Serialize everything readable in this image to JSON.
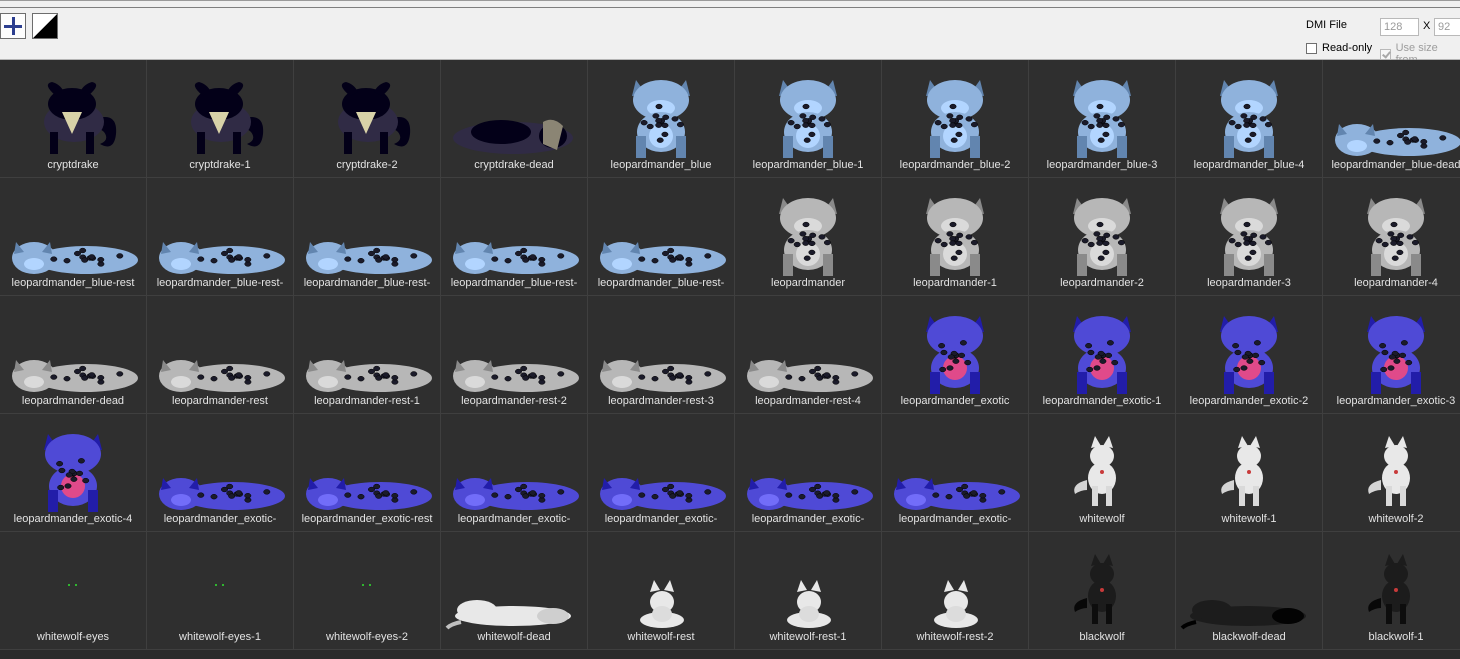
{
  "toolbar": {
    "add_button": "add",
    "invert_button": "invert",
    "dmi_label": "DMI File",
    "width_value": "128",
    "size_x": "X",
    "height_value": "92",
    "readonly_label": "Read-only",
    "readonly_checked": false,
    "usesize_label": "Use size from",
    "usesize_checked": true
  },
  "palette": {
    "cryptdrake": "#302b45",
    "leopard_blue": "#8fb2dc",
    "leopard_grey": "#b7b7b7",
    "leopard_exotic": "#4f4ad6",
    "exotic_belly": "#e04a8a",
    "whitewolf": "#e8e8e8",
    "blackwolf": "#1c1c1c",
    "eyes": "#2fb52f"
  },
  "icons": [
    {
      "label": "cryptdrake",
      "kind": "drake",
      "color": "cryptdrake"
    },
    {
      "label": "cryptdrake-1",
      "kind": "drake",
      "color": "cryptdrake"
    },
    {
      "label": "cryptdrake-2",
      "kind": "drake",
      "color": "cryptdrake"
    },
    {
      "label": "cryptdrake-dead",
      "kind": "drake-lying",
      "color": "cryptdrake"
    },
    {
      "label": "leopardmander_blue",
      "kind": "sit",
      "color": "leopard_blue"
    },
    {
      "label": "leopardmander_blue-1",
      "kind": "sit",
      "color": "leopard_blue"
    },
    {
      "label": "leopardmander_blue-2",
      "kind": "sit",
      "color": "leopard_blue"
    },
    {
      "label": "leopardmander_blue-3",
      "kind": "sit",
      "color": "leopard_blue"
    },
    {
      "label": "leopardmander_blue-4",
      "kind": "sit",
      "color": "leopard_blue"
    },
    {
      "label": "leopardmander_blue-dead",
      "kind": "rest",
      "color": "leopard_blue"
    },
    {
      "label": "leopardmander_blue-rest",
      "kind": "rest",
      "color": "leopard_blue"
    },
    {
      "label": "leopardmander_blue-rest-",
      "kind": "rest",
      "color": "leopard_blue"
    },
    {
      "label": "leopardmander_blue-rest-",
      "kind": "rest",
      "color": "leopard_blue"
    },
    {
      "label": "leopardmander_blue-rest-",
      "kind": "rest",
      "color": "leopard_blue"
    },
    {
      "label": "leopardmander_blue-rest-",
      "kind": "rest",
      "color": "leopard_blue"
    },
    {
      "label": "leopardmander",
      "kind": "sit",
      "color": "leopard_grey"
    },
    {
      "label": "leopardmander-1",
      "kind": "sit",
      "color": "leopard_grey"
    },
    {
      "label": "leopardmander-2",
      "kind": "sit",
      "color": "leopard_grey"
    },
    {
      "label": "leopardmander-3",
      "kind": "sit",
      "color": "leopard_grey"
    },
    {
      "label": "leopardmander-4",
      "kind": "sit",
      "color": "leopard_grey"
    },
    {
      "label": "leopardmander-dead",
      "kind": "rest",
      "color": "leopard_grey"
    },
    {
      "label": "leopardmander-rest",
      "kind": "rest",
      "color": "leopard_grey"
    },
    {
      "label": "leopardmander-rest-1",
      "kind": "rest",
      "color": "leopard_grey"
    },
    {
      "label": "leopardmander-rest-2",
      "kind": "rest",
      "color": "leopard_grey"
    },
    {
      "label": "leopardmander-rest-3",
      "kind": "rest",
      "color": "leopard_grey"
    },
    {
      "label": "leopardmander-rest-4",
      "kind": "rest",
      "color": "leopard_grey"
    },
    {
      "label": "leopardmander_exotic",
      "kind": "sit-exotic",
      "color": "leopard_exotic"
    },
    {
      "label": "leopardmander_exotic-1",
      "kind": "sit-exotic",
      "color": "leopard_exotic"
    },
    {
      "label": "leopardmander_exotic-2",
      "kind": "sit-exotic",
      "color": "leopard_exotic"
    },
    {
      "label": "leopardmander_exotic-3",
      "kind": "sit-exotic",
      "color": "leopard_exotic"
    },
    {
      "label": "leopardmander_exotic-4",
      "kind": "sit-exotic",
      "color": "leopard_exotic"
    },
    {
      "label": "leopardmander_exotic-",
      "kind": "rest",
      "color": "leopard_exotic"
    },
    {
      "label": "leopardmander_exotic-rest",
      "kind": "rest",
      "color": "leopard_exotic"
    },
    {
      "label": "leopardmander_exotic-",
      "kind": "rest",
      "color": "leopard_exotic"
    },
    {
      "label": "leopardmander_exotic-",
      "kind": "rest",
      "color": "leopard_exotic"
    },
    {
      "label": "leopardmander_exotic-",
      "kind": "rest",
      "color": "leopard_exotic"
    },
    {
      "label": "leopardmander_exotic-",
      "kind": "rest",
      "color": "leopard_exotic"
    },
    {
      "label": "whitewolf",
      "kind": "wolf",
      "color": "whitewolf"
    },
    {
      "label": "whitewolf-1",
      "kind": "wolf",
      "color": "whitewolf"
    },
    {
      "label": "whitewolf-2",
      "kind": "wolf",
      "color": "whitewolf"
    },
    {
      "label": "whitewolf-eyes",
      "kind": "eyes",
      "color": "eyes"
    },
    {
      "label": "whitewolf-eyes-1",
      "kind": "eyes",
      "color": "eyes"
    },
    {
      "label": "whitewolf-eyes-2",
      "kind": "eyes",
      "color": "eyes"
    },
    {
      "label": "whitewolf-dead",
      "kind": "wolf-lying",
      "color": "whitewolf"
    },
    {
      "label": "whitewolf-rest",
      "kind": "wolf-rest",
      "color": "whitewolf"
    },
    {
      "label": "whitewolf-rest-1",
      "kind": "wolf-rest",
      "color": "whitewolf"
    },
    {
      "label": "whitewolf-rest-2",
      "kind": "wolf-rest",
      "color": "whitewolf"
    },
    {
      "label": "blackwolf",
      "kind": "wolf",
      "color": "blackwolf"
    },
    {
      "label": "blackwolf-dead",
      "kind": "wolf-lying",
      "color": "blackwolf"
    },
    {
      "label": "blackwolf-1",
      "kind": "wolf",
      "color": "blackwolf"
    }
  ]
}
